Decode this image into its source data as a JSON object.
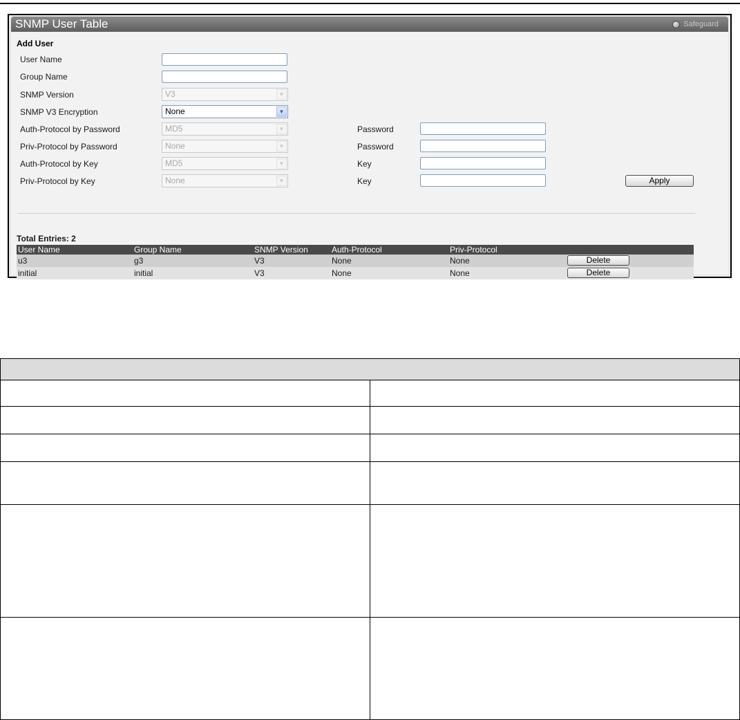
{
  "window": {
    "title": "SNMP User Table",
    "badge": "Safeguard"
  },
  "form": {
    "section_title": "Add User",
    "user_name_label": "User Name",
    "group_name_label": "Group Name",
    "snmp_version_label": "SNMP Version",
    "snmp_version_value": "V3",
    "encryption_label": "SNMP V3 Encryption",
    "encryption_value": "None",
    "auth_pw_label": "Auth-Protocol by Password",
    "auth_pw_value": "MD5",
    "priv_pw_label": "Priv-Protocol by Password",
    "priv_pw_value": "None",
    "auth_key_label": "Auth-Protocol by Key",
    "auth_key_value": "MD5",
    "priv_key_label": "Priv-Protocol by Key",
    "priv_key_value": "None",
    "password_label_1": "Password",
    "password_label_2": "Password",
    "key_label_1": "Key",
    "key_label_2": "Key",
    "apply_label": "Apply"
  },
  "table": {
    "total": "Total Entries: 2",
    "headers": [
      "User Name",
      "Group Name",
      "SNMP Version",
      "Auth-Protocol",
      "Priv-Protocol"
    ],
    "rows": [
      [
        "u3",
        "g3",
        "V3",
        "None",
        "None"
      ],
      [
        "initial",
        "initial",
        "V3",
        "None",
        "None"
      ]
    ],
    "delete_label": "Delete"
  },
  "colors": {
    "header_bar": "#5e5e5e",
    "table_header": "#4a4a4a",
    "row_alt": "#cfcfcf"
  }
}
